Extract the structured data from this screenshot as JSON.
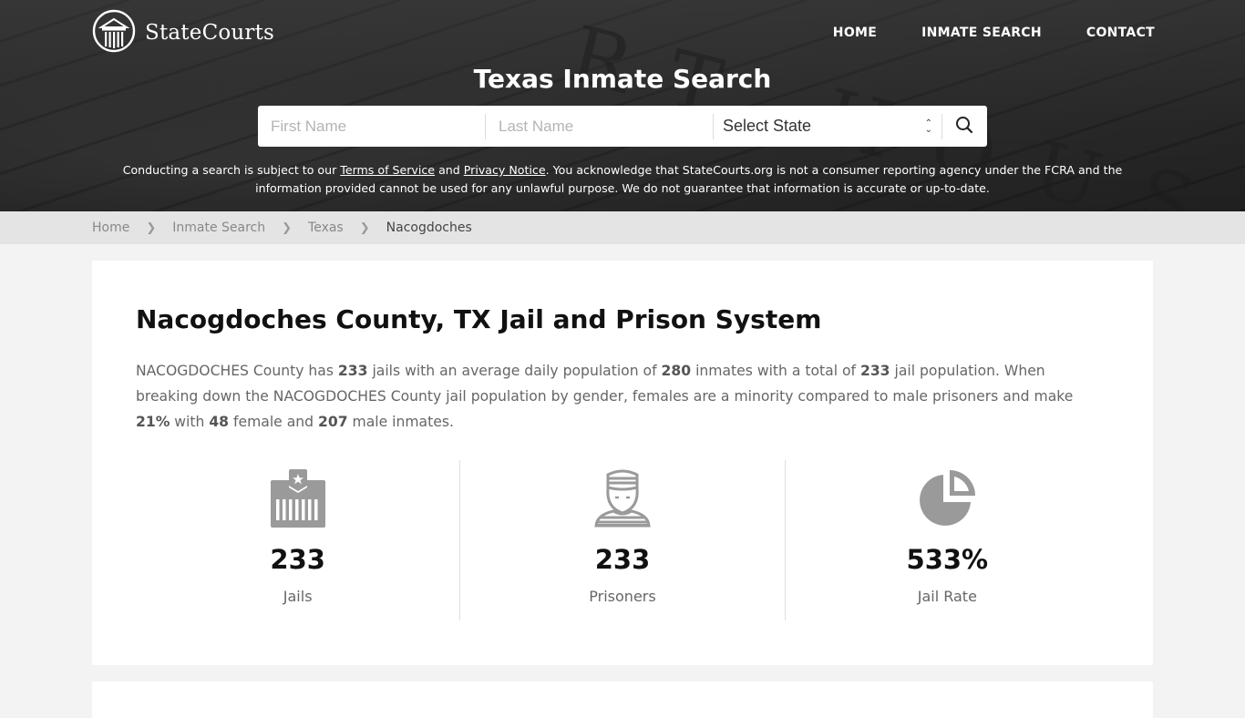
{
  "header": {
    "logo_text": "StateCourts",
    "nav": [
      {
        "label": "HOME"
      },
      {
        "label": "INMATE SEARCH"
      },
      {
        "label": "CONTACT"
      }
    ],
    "background_letters": "RT HOUSE",
    "title": "Texas Inmate Search"
  },
  "search": {
    "first_name_placeholder": "First Name",
    "last_name_placeholder": "Last Name",
    "state_selected": "Select State",
    "search_icon": "search-icon"
  },
  "disclaimer": {
    "part1": "Conducting a search is subject to our ",
    "terms_link": "Terms of Service",
    "part2": " and ",
    "privacy_link": "Privacy Notice",
    "part3": ". You acknowledge that StateCourts.org is not a consumer reporting agency under the FCRA and the information provided cannot be used for any unlawful purpose. We do not guarantee that information is accurate or up-to-date."
  },
  "breadcrumb": {
    "items": [
      {
        "label": "Home"
      },
      {
        "label": "Inmate Search"
      },
      {
        "label": "Texas"
      },
      {
        "label": "Nacogdoches"
      }
    ]
  },
  "main": {
    "title": "Nacogdoches County, TX Jail and Prison System",
    "summary": {
      "t1": "NACOGDOCHES County has ",
      "jails": "233",
      "t2": " jails with an average daily population of ",
      "adp": "280",
      "t3": " inmates with a total of ",
      "total": "233",
      "t4": " jail population. When breaking down the NACOGDOCHES County jail population by gender, females are a minority compared to male prisoners and make ",
      "female_pct": "21%",
      "t5": " with ",
      "female": "48",
      "t6": " female and ",
      "male": "207",
      "t7": " male inmates."
    },
    "stats": [
      {
        "icon": "jail-building-icon",
        "value": "233",
        "label": "Jails"
      },
      {
        "icon": "prisoner-icon",
        "value": "233",
        "label": "Prisoners"
      },
      {
        "icon": "pie-chart-icon",
        "value": "533%",
        "label": "Jail Rate"
      }
    ]
  },
  "colors": {
    "icon_gray": "#9a9a9a",
    "breadcrumb_bg": "#e4e4e4",
    "page_bg": "#f3f3f3"
  }
}
